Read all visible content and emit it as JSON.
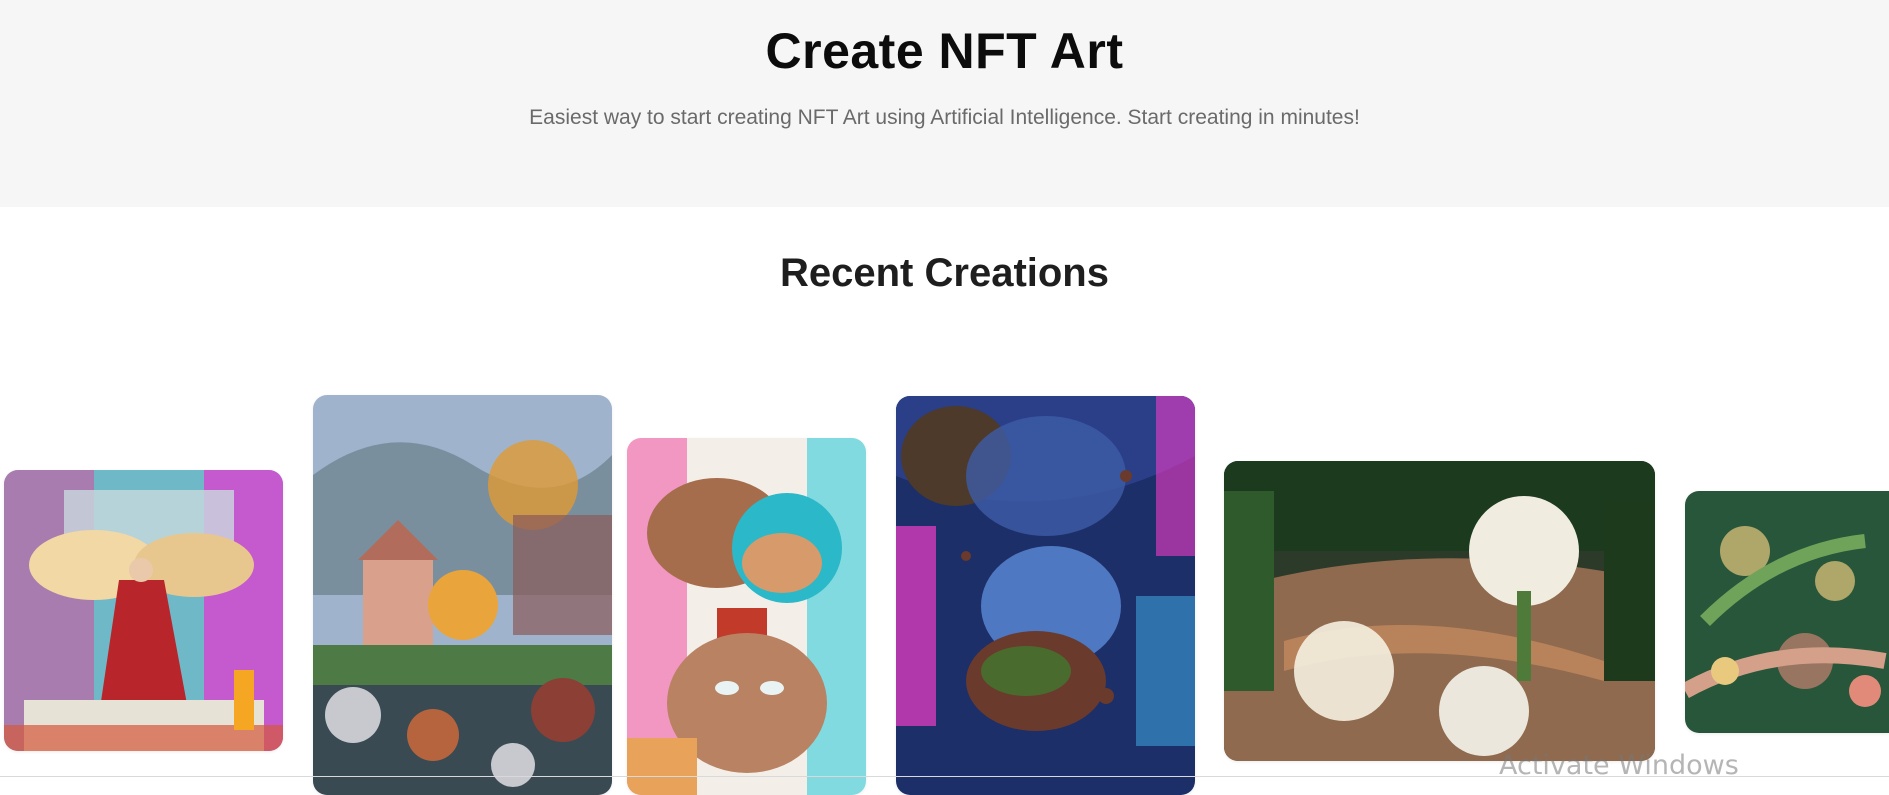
{
  "hero": {
    "title": "Create NFT Art",
    "subtitle": "Easiest way to start creating NFT Art using Artificial Intelligence. Start creating in minutes!",
    "background": "#f6f6f6"
  },
  "recent": {
    "title": "Recent Creations",
    "cards": [
      {
        "alt": "winged figure in red robe painting",
        "palette": [
          "#e23ad0",
          "#f0c68a",
          "#2ec6d8",
          "#b8252a"
        ]
      },
      {
        "alt": "stadium crowd with autumn trees painting",
        "palette": [
          "#8da9c5",
          "#e09a35",
          "#4d7a45",
          "#c7c9cf"
        ]
      },
      {
        "alt": "surreal stacked faces painting",
        "palette": [
          "#22c9d8",
          "#f04fa0",
          "#e8a25a",
          "#8b6048"
        ]
      },
      {
        "alt": "cosmic face with meteor painting",
        "palette": [
          "#1c2f68",
          "#f03cc8",
          "#3ca0d8",
          "#5a2a22"
        ]
      },
      {
        "alt": "white flowers in forest painting",
        "palette": [
          "#1b3a1e",
          "#f0ece0",
          "#9b6a45",
          "#4e7a3a"
        ]
      },
      {
        "alt": "ferns with bokeh light painting",
        "palette": [
          "#27563a",
          "#e9c97e",
          "#e28a7a",
          "#6fa35a"
        ]
      }
    ]
  },
  "system": {
    "watermark": "Activate Windows"
  }
}
